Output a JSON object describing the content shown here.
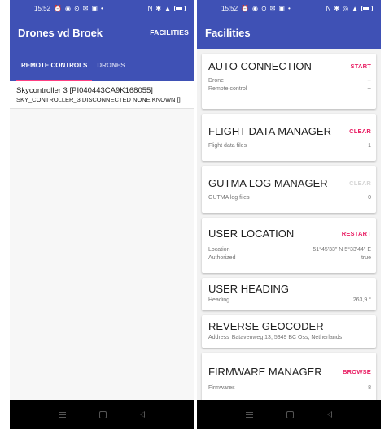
{
  "left": {
    "status": {
      "time": "15:52"
    },
    "app_title": "Drones vd Broek",
    "action": "FACILITIES",
    "tabs": [
      "REMOTE CONTROLS",
      "DRONES"
    ],
    "remote_controls": [
      {
        "title": "Skycontroller 3 [PI040443CA9K168055]",
        "subtitle": "SKY_CONTROLLER_3 DISCONNECTED NONE KNOWN []"
      }
    ]
  },
  "right": {
    "status": {
      "time": "15:52"
    },
    "app_title": "Facilities",
    "cards": {
      "auto_connection": {
        "title": "AUTO CONNECTION",
        "action": "START",
        "rows": [
          {
            "label": "Drone",
            "value": "--"
          },
          {
            "label": "Remote control",
            "value": "--"
          }
        ]
      },
      "flight_data": {
        "title": "FLIGHT DATA MANAGER",
        "action": "CLEAR",
        "rows": [
          {
            "label": "Flight data files",
            "value": "1"
          }
        ]
      },
      "gutma": {
        "title": "GUTMA LOG MANAGER",
        "action": "CLEAR",
        "rows": [
          {
            "label": "GUTMA log files",
            "value": "0"
          }
        ]
      },
      "user_location": {
        "title": "USER LOCATION",
        "action": "RESTART",
        "rows": [
          {
            "label": "Location",
            "value": "51°45'33\" N 5°33'44\" E"
          },
          {
            "label": "Authorized",
            "value": "true"
          }
        ]
      },
      "user_heading": {
        "title": "USER HEADING",
        "rows": [
          {
            "label": "Heading",
            "value": "263,9 °"
          }
        ]
      },
      "reverse_geocoder": {
        "title": "REVERSE GEOCODER",
        "rows": [
          {
            "label": "Address",
            "value": "Batavenweg 13, 5349 BC Oss, Netherlands"
          }
        ]
      },
      "firmware": {
        "title": "FIRMWARE MANAGER",
        "action": "BROWSE",
        "rows": [
          {
            "label": "Firmwares",
            "value": "8"
          }
        ]
      }
    }
  },
  "colors": {
    "primary": "#3f51b5",
    "accent": "#e91e63",
    "tab_indicator": "#ff4081"
  },
  "icons": {
    "status_left": [
      "alarm-icon",
      "notification-icon",
      "messenger-icon",
      "mail-icon",
      "gallery-icon",
      "dot-icon"
    ],
    "status_right": [
      "nfc-icon",
      "bluetooth-icon",
      "wifi-icon",
      "signal-icon",
      "battery-icon"
    ],
    "nav": [
      "menu-icon",
      "home-icon",
      "back-icon"
    ]
  }
}
